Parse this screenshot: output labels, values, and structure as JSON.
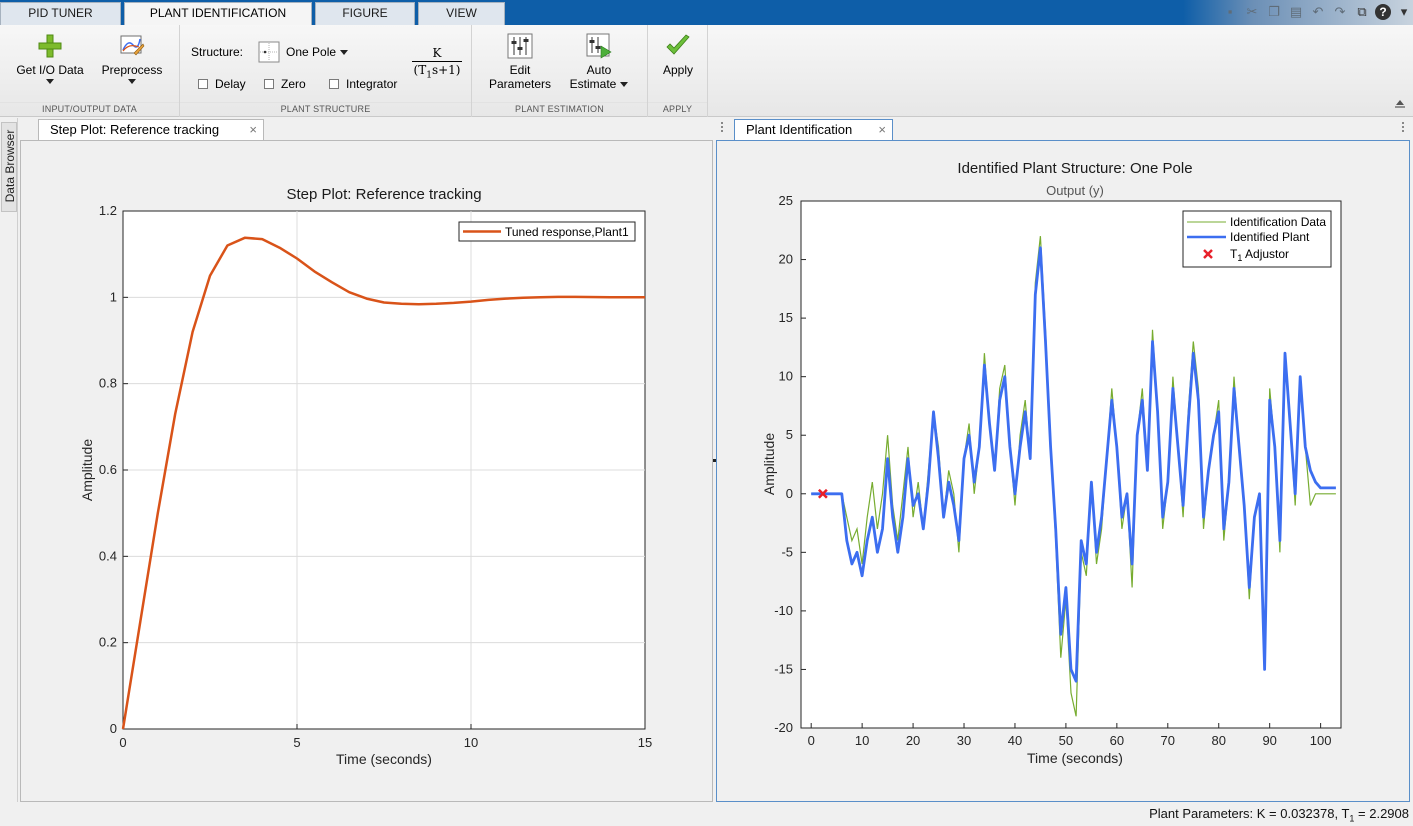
{
  "ribbon_tabs": [
    "PID TUNER",
    "PLANT IDENTIFICATION",
    "FIGURE",
    "VIEW"
  ],
  "toolstrip": {
    "io": {
      "title": "INPUT/OUTPUT DATA",
      "get_io": "Get I/O Data",
      "preprocess": "Preprocess"
    },
    "structure": {
      "title": "PLANT STRUCTURE",
      "label": "Structure:",
      "value": "One Pole",
      "delay": "Delay",
      "zero": "Zero",
      "integrator": "Integrator",
      "tf_num": "K",
      "tf_den": "(T",
      "tf_den_sub": "1",
      "tf_den_rest": "s+1)"
    },
    "estimation": {
      "title": "PLANT ESTIMATION",
      "edit_1": "Edit",
      "edit_2": "Parameters",
      "auto_1": "Auto",
      "auto_2": "Estimate"
    },
    "apply": {
      "title": "APPLY",
      "label": "Apply"
    }
  },
  "side_tab": "Data Browser",
  "left_doc": {
    "tab_label": "Step Plot: Reference tracking",
    "close": "×"
  },
  "right_doc": {
    "tab_label": "Plant Identification",
    "close": "×"
  },
  "status": {
    "prefix": "Plant Parameters: K = 0.032378, T",
    "sub": "1",
    "suffix": " = 2.2908"
  },
  "colors": {
    "step_line": "#d95319",
    "ident_data": "#77ac30",
    "ident_plant": "#3c6ef0",
    "adjustor": "#e8202a",
    "ribbon_blue": "#0e5ea8"
  },
  "chart_data": [
    {
      "type": "line",
      "title": "Step Plot: Reference tracking",
      "xlabel": "Time (seconds)",
      "ylabel": "Amplitude",
      "xlim": [
        0,
        15
      ],
      "ylim": [
        0,
        1.2
      ],
      "xticks": [
        0,
        5,
        10,
        15
      ],
      "yticks": [
        0,
        0.2,
        0.4,
        0.6,
        0.8,
        1,
        1.2
      ],
      "ytick_labels": [
        "0",
        "0.2",
        "0.4",
        "0.6",
        "0.8",
        "1",
        "1.2"
      ],
      "grid": true,
      "legend_position": "top-right",
      "series": [
        {
          "name": "Tuned response,Plant1",
          "x": [
            0,
            0.5,
            1,
            1.5,
            2,
            2.5,
            3,
            3.5,
            4,
            4.5,
            5,
            5.5,
            6,
            6.5,
            7,
            7.5,
            8,
            8.5,
            9,
            9.5,
            10,
            10.5,
            11,
            11.5,
            12,
            12.5,
            13,
            14,
            15
          ],
          "y": [
            0,
            0.25,
            0.5,
            0.73,
            0.92,
            1.05,
            1.12,
            1.138,
            1.135,
            1.115,
            1.09,
            1.06,
            1.035,
            1.012,
            0.997,
            0.988,
            0.985,
            0.984,
            0.985,
            0.987,
            0.99,
            0.994,
            0.997,
            0.999,
            1.0,
            1.001,
            1.001,
            1.0,
            1.0
          ]
        }
      ]
    },
    {
      "type": "line",
      "title": "Identified Plant Structure: One Pole",
      "subtitle": "Output (y)",
      "xlabel": "Time (seconds)",
      "ylabel": "Amplitude",
      "xlim": [
        -2,
        104
      ],
      "ylim": [
        -20,
        25
      ],
      "xticks": [
        0,
        10,
        20,
        30,
        40,
        50,
        60,
        70,
        80,
        90,
        100
      ],
      "yticks": [
        -20,
        -15,
        -10,
        -5,
        0,
        5,
        10,
        15,
        20,
        25
      ],
      "grid": false,
      "legend_position": "top-right",
      "series": [
        {
          "name": "Identification Data",
          "x": [
            0,
            6,
            7,
            8,
            9,
            10,
            11,
            12,
            13,
            14,
            15,
            16,
            17,
            18,
            19,
            20,
            21,
            22,
            23,
            24,
            25,
            26,
            27,
            28,
            29,
            30,
            31,
            32,
            33,
            34,
            35,
            36,
            37,
            38,
            39,
            40,
            41,
            42,
            43,
            44,
            45,
            46,
            47,
            48,
            49,
            50,
            51,
            52,
            53,
            54,
            55,
            56,
            57,
            58,
            59,
            60,
            61,
            62,
            63,
            64,
            65,
            66,
            67,
            68,
            69,
            70,
            71,
            72,
            73,
            74,
            75,
            76,
            77,
            78,
            79,
            80,
            81,
            82,
            83,
            84,
            85,
            86,
            87,
            88,
            89,
            90,
            91,
            92,
            93,
            94,
            95,
            96,
            97,
            98,
            99,
            100,
            101,
            102,
            103
          ],
          "y": [
            0,
            0,
            -2,
            -4,
            -3,
            -6,
            -2,
            1,
            -3,
            0,
            5,
            -1,
            -4,
            0,
            4,
            -2,
            1,
            -3,
            2,
            7,
            4,
            -2,
            2,
            0,
            -5,
            3,
            6,
            0,
            4,
            12,
            6,
            2,
            9,
            11,
            4,
            -1,
            5,
            8,
            3,
            18,
            22,
            14,
            4,
            -4,
            -14,
            -9,
            -17,
            -19,
            -5,
            -7,
            1,
            -6,
            -3,
            3,
            9,
            4,
            -3,
            0,
            -8,
            5,
            9,
            2,
            14,
            7,
            -3,
            1,
            10,
            4,
            -2,
            7,
            13,
            9,
            -3,
            2,
            5,
            8,
            -4,
            1,
            10,
            4,
            -1,
            -9,
            -2,
            0,
            -14,
            9,
            4,
            -5,
            12,
            6,
            -1,
            10,
            4,
            -1,
            0,
            0,
            0,
            0,
            0
          ]
        },
        {
          "name": "Identified Plant",
          "x": [
            0,
            6,
            7,
            8,
            9,
            10,
            11,
            12,
            13,
            14,
            15,
            16,
            17,
            18,
            19,
            20,
            21,
            22,
            23,
            24,
            25,
            26,
            27,
            28,
            29,
            30,
            31,
            32,
            33,
            34,
            35,
            36,
            37,
            38,
            39,
            40,
            41,
            42,
            43,
            44,
            45,
            46,
            47,
            48,
            49,
            50,
            51,
            52,
            53,
            54,
            55,
            56,
            57,
            58,
            59,
            60,
            61,
            62,
            63,
            64,
            65,
            66,
            67,
            68,
            69,
            70,
            71,
            72,
            73,
            74,
            75,
            76,
            77,
            78,
            79,
            80,
            81,
            82,
            83,
            84,
            85,
            86,
            87,
            88,
            89,
            90,
            91,
            92,
            93,
            94,
            95,
            96,
            97,
            98,
            99,
            100,
            101,
            102,
            103
          ],
          "y": [
            0,
            0,
            -4,
            -6,
            -5,
            -7,
            -4,
            -2,
            -5,
            -3,
            3,
            -2,
            -5,
            -2,
            3,
            -1,
            0,
            -3,
            1,
            7,
            3,
            -2,
            1,
            -1,
            -4,
            3,
            5,
            1,
            4,
            11,
            6,
            2,
            8,
            10,
            4,
            0,
            4,
            7,
            3,
            17,
            21,
            13,
            4,
            -3,
            -12,
            -8,
            -15,
            -16,
            -4,
            -6,
            1,
            -5,
            -2,
            3,
            8,
            4,
            -2,
            0,
            -6,
            5,
            8,
            2,
            13,
            7,
            -2,
            1,
            9,
            4,
            -1,
            6,
            12,
            8,
            -2,
            2,
            5,
            7,
            -3,
            1,
            9,
            4,
            -1,
            -8,
            -2,
            0,
            -15,
            8,
            4,
            -4,
            12,
            6,
            0,
            10,
            4,
            2,
            1,
            0.5,
            0.5,
            0.5,
            0.5
          ]
        },
        {
          "name": "T1 Adjustor",
          "x": [
            2.29
          ],
          "y": [
            0
          ]
        }
      ],
      "legend_labels": {
        "data": "Identification Data",
        "plant": "Identified Plant",
        "adjustor_prefix": "T",
        "adjustor_sub": "1",
        "adjustor_suffix": " Adjustor"
      }
    }
  ]
}
